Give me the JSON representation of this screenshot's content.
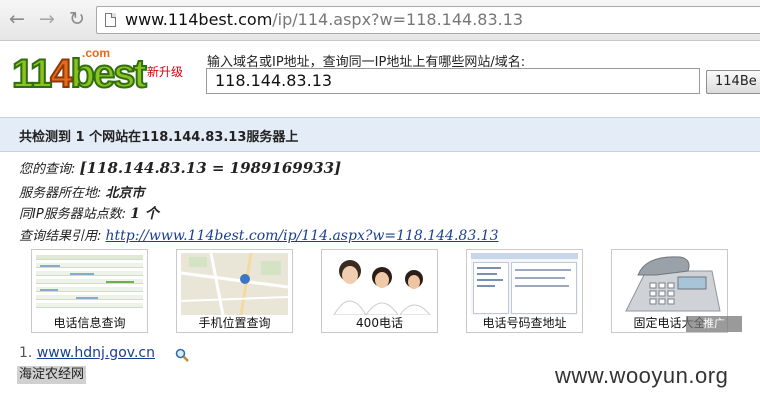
{
  "browser": {
    "back_icon": "back-arrow-icon",
    "forward_icon": "forward-arrow-icon",
    "reload_icon": "reload-icon",
    "url_host": "www.114best.com",
    "url_path": "/ip/114.aspx?w=118.144.83.13"
  },
  "header": {
    "logo_com": ".com",
    "logo_part1": "11",
    "logo_part2": "4",
    "logo_part3": "best",
    "new_upgrade": "新升级",
    "search_prompt": "输入域名或IP地址，查询同一IP地址上有哪些网站/域名:",
    "search_value": "118.144.83.13",
    "query_button": "114Be"
  },
  "result": {
    "title": "共检测到 1 个网站在118.144.83.13服务器上",
    "query_label": "您的查询: ",
    "query_value": "[118.144.83.13 = 1989169933]",
    "location_label": "服务器所在地: ",
    "location_value": "北京市",
    "count_label": "同IP服务器站点数: ",
    "count_value": "1 个",
    "cite_label": "查询结果引用: ",
    "cite_link": "http://www.114best.com/ip/114.aspx?w=118.144.83.13"
  },
  "thumbnails": [
    {
      "caption": "电话信息查询"
    },
    {
      "caption": "手机位置查询"
    },
    {
      "caption": "400电话"
    },
    {
      "caption": "电话号码查地址"
    },
    {
      "caption": "固定电话大全"
    }
  ],
  "ad_tag": "推广",
  "list": [
    {
      "index": "1.",
      "domain": "www.hdnj.gov.cn",
      "name": "海淀农经网"
    }
  ],
  "watermark": "www.wooyun.org",
  "colors": {
    "result_bar": "#e4ecf7",
    "link": "#1a3f8f",
    "logo_green": "#8cc21d",
    "logo_orange": "#e8691c"
  }
}
